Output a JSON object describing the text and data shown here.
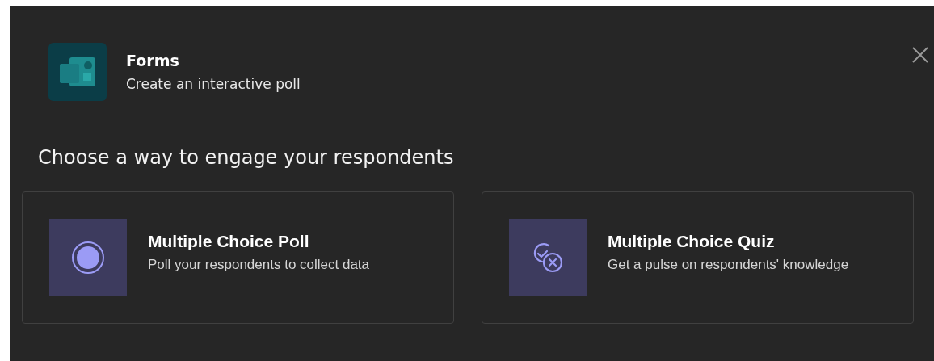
{
  "app": {
    "name": "Forms",
    "subtitle": "Create an interactive poll"
  },
  "heading": "Choose a way to engage your respondents",
  "options": [
    {
      "kind": "poll",
      "title": "Multiple Choice Poll",
      "description": "Poll your respondents to collect data"
    },
    {
      "kind": "quiz",
      "title": "Multiple Choice Quiz",
      "description": "Get a pulse on respondents' knowledge"
    }
  ]
}
